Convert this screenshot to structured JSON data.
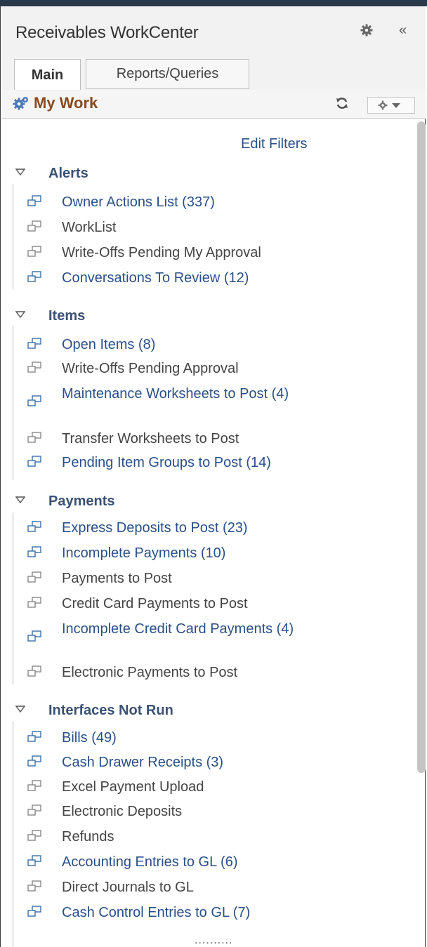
{
  "app": {
    "title": "Receivables WorkCenter"
  },
  "tabs": [
    {
      "label": "Main",
      "active": true
    },
    {
      "label": "Reports/Queries",
      "active": false
    }
  ],
  "pagelet": {
    "title": "My Work",
    "edit_filters": "Edit Filters"
  },
  "sections": [
    {
      "title": "Alerts",
      "items": [
        {
          "label": "Owner Actions List (337)",
          "active": true
        },
        {
          "label": "WorkList",
          "active": false
        },
        {
          "label": "Write-Offs Pending My Approval",
          "active": false
        },
        {
          "label": "Conversations To Review (12)",
          "active": true
        }
      ]
    },
    {
      "title": "Items",
      "items": [
        {
          "label": "Open Items (8)",
          "active": true
        },
        {
          "label": "Write-Offs Pending Approval",
          "active": false
        },
        {
          "label": "Maintenance Worksheets to Post (4)",
          "active": true
        },
        {
          "label": "Transfer Worksheets to Post",
          "active": false
        },
        {
          "label": "Pending Item Groups to Post (14)",
          "active": true
        }
      ]
    },
    {
      "title": "Payments",
      "items": [
        {
          "label": "Express Deposits to Post (23)",
          "active": true
        },
        {
          "label": "Incomplete Payments (10)",
          "active": true
        },
        {
          "label": "Payments to Post",
          "active": false
        },
        {
          "label": "Credit Card Payments to Post",
          "active": false
        },
        {
          "label": "Incomplete Credit Card Payments (4)",
          "active": true
        },
        {
          "label": "Electronic Payments to Post",
          "active": false
        }
      ]
    },
    {
      "title": "Interfaces Not Run",
      "items": [
        {
          "label": "Bills (49)",
          "active": true
        },
        {
          "label": "Cash Drawer Receipts (3)",
          "active": true
        },
        {
          "label": "Excel Payment Upload",
          "active": false
        },
        {
          "label": "Electronic Deposits",
          "active": false
        },
        {
          "label": "Refunds",
          "active": false
        },
        {
          "label": "Accounting Entries to GL (6)",
          "active": true
        },
        {
          "label": "Direct Journals to GL",
          "active": false
        },
        {
          "label": "Cash Control Entries to GL (7)",
          "active": true
        }
      ]
    }
  ],
  "footer": {
    "more_indicator": ".........."
  },
  "colors": {
    "link": "#2a4f87",
    "inactive_text": "#444444",
    "section_title": "#3a5175",
    "mywork_title": "#8a4b1f"
  },
  "icons": {
    "header_settings": "gear-icon",
    "header_collapse": "collapse-left-icon",
    "pagelet": "gears-icon",
    "refresh": "refresh-icon",
    "options": "gear-dropdown-icon",
    "section_toggle": "triangle-down-icon",
    "item": "window-icon"
  }
}
